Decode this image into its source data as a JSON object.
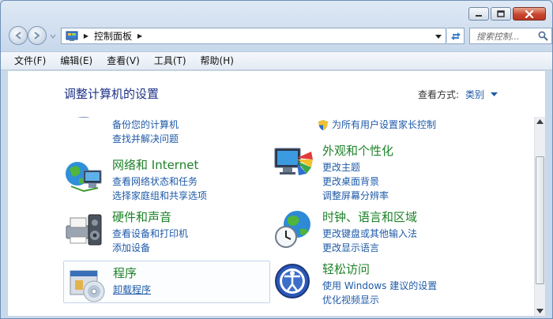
{
  "window": {
    "minimize_symbol": "—",
    "maximize_symbol": "☐",
    "close_symbol": "✕"
  },
  "address": {
    "path": [
      "控制面板"
    ],
    "search_placeholder": "搜索控制..."
  },
  "menu": [
    "文件(F)",
    "编辑(E)",
    "查看(V)",
    "工具(T)",
    "帮助(H)"
  ],
  "header": {
    "title": "调整计算机的设置",
    "view_by_label": "查看方式:",
    "view_by_value": "类别"
  },
  "categories_left": [
    {
      "title": "",
      "links": [
        "备份您的计算机",
        "查找并解决问题"
      ],
      "icon": "system-security-icon"
    },
    {
      "title": "网络和 Internet",
      "links": [
        "查看网络状态和任务",
        "选择家庭组和共享选项"
      ],
      "icon": "network-globe-icon"
    },
    {
      "title": "硬件和声音",
      "links": [
        "查看设备和打印机",
        "添加设备"
      ],
      "icon": "printer-speaker-icon"
    },
    {
      "title": "程序",
      "links": [
        "卸载程序"
      ],
      "icon": "programs-cd-icon"
    }
  ],
  "categories_right": [
    {
      "title": "",
      "links": [
        "为所有用户设置家长控制"
      ],
      "icon": "user-accounts-icon"
    },
    {
      "title": "外观和个性化",
      "links": [
        "更改主题",
        "更改桌面背景",
        "调整屏幕分辨率"
      ],
      "icon": "appearance-monitor-icon"
    },
    {
      "title": "时钟、语言和区域",
      "links": [
        "更改键盘或其他输入法",
        "更改显示语言"
      ],
      "icon": "clock-globe-icon"
    },
    {
      "title": "轻松访问",
      "links": [
        "使用 Windows 建议的设置",
        "优化视频显示"
      ],
      "icon": "ease-of-access-icon"
    }
  ],
  "colors": {
    "title_green": "#1d8228",
    "link_blue": "#1e5aa8",
    "heading_navy": "#1e3287"
  }
}
